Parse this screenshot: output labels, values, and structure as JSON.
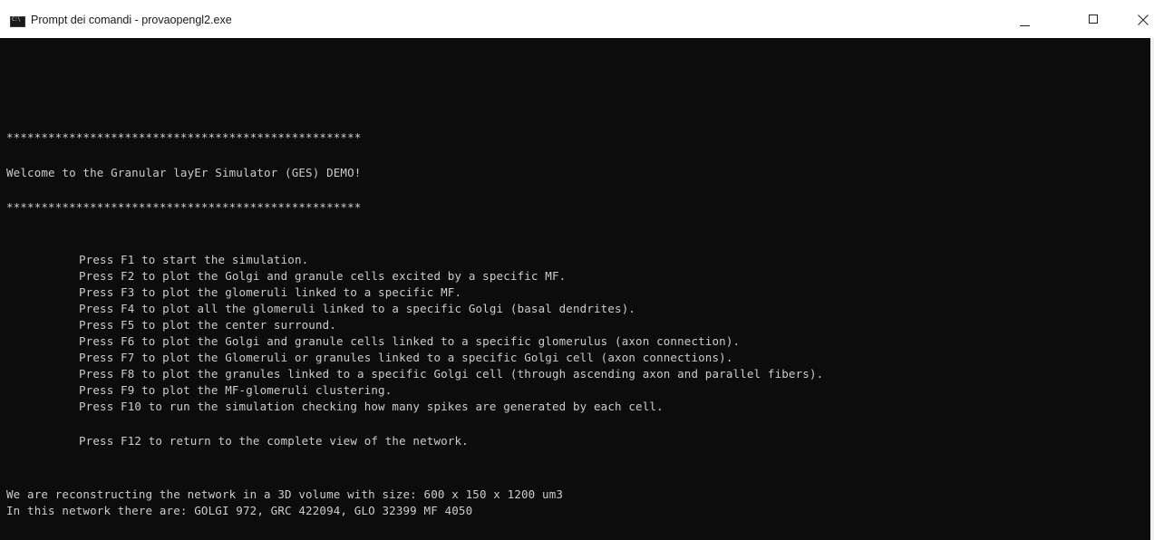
{
  "window": {
    "title": "Prompt dei comandi - provaopengl2.exe",
    "icon": "cmd-icon",
    "controls": [
      "minimize-icon",
      "maximize-icon",
      "close-icon"
    ]
  },
  "console": {
    "banner_top": "***************************************************",
    "welcome": "Welcome to the Granular layEr Simulator (GES) DEMO!",
    "banner_bottom": "***************************************************",
    "instructions": [
      "Press F1 to start the simulation.",
      "Press F2 to plot the Golgi and granule cells excited by a specific MF.",
      "Press F3 to plot the glomeruli linked to a specific MF.",
      "Press F4 to plot all the glomeruli linked to a specific Golgi (basal dendrites).",
      "Press F5 to plot the center surround.",
      "Press F6 to plot the Golgi and granule cells linked to a specific glomerulus (axon connection).",
      "Press F7 to plot the Glomeruli or granules linked to a specific Golgi cell (axon connections).",
      "Press F8 to plot the granules linked to a specific Golgi cell (through ascending axon and parallel fibers).",
      "Press F9 to plot the MF-glomeruli clustering.",
      "Press F10 to run the simulation checking how many spikes are generated by each cell."
    ],
    "return_instruction": "Press F12 to return to the complete view of the network.",
    "volume_info": "We are reconstructing the network in a 3D volume with size: 600 x 150 x 1200 um3",
    "network_info": "In this network there are: GOLGI 972, GRC 422094, GLO 32399 MF 4050"
  },
  "colors": {
    "console_background": "#0c0c0c",
    "console_text": "#cccccc",
    "titlebar_background": "#ffffff"
  }
}
